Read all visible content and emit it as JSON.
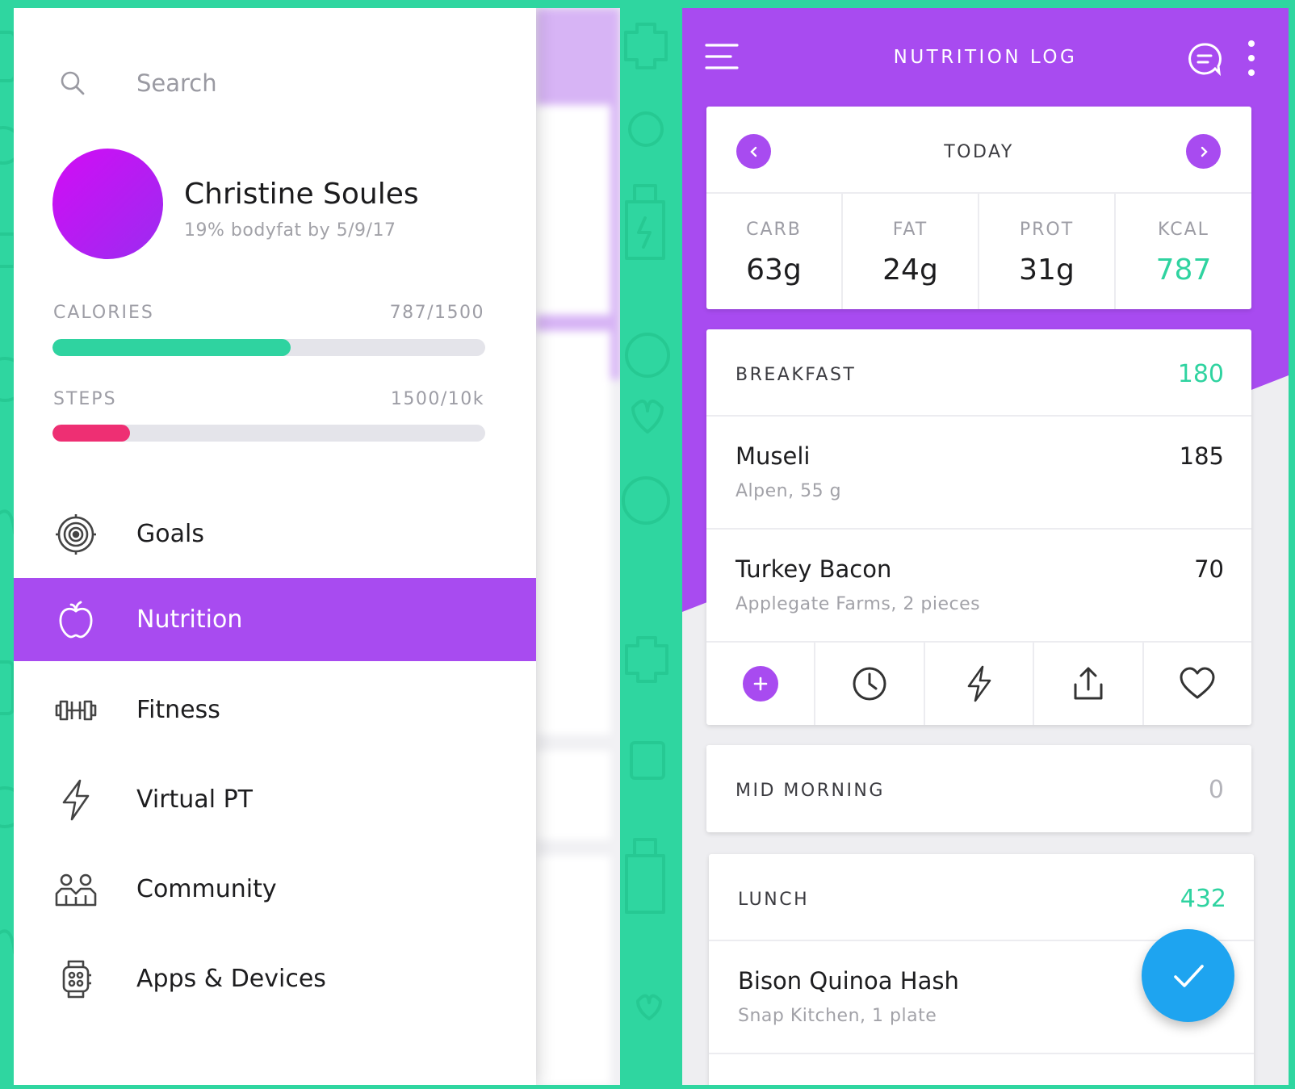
{
  "drawer": {
    "search_placeholder": "Search",
    "profile": {
      "name": "Christine Soules",
      "goal": "19% bodyfat by 5/9/17"
    },
    "stats": [
      {
        "label": "CALORIES",
        "value": "787/1500",
        "progress": 0.55,
        "color": "#2fd3a0"
      },
      {
        "label": "STEPS",
        "value": "1500/10k",
        "progress": 0.18,
        "color": "#ee2f73"
      }
    ],
    "nav": [
      {
        "label": "Goals",
        "icon": "target-icon",
        "active": false
      },
      {
        "label": "Nutrition",
        "icon": "apple-icon",
        "active": true
      },
      {
        "label": "Fitness",
        "icon": "dumbbell-icon",
        "active": false
      },
      {
        "label": "Virtual PT",
        "icon": "lightning-icon",
        "active": false
      },
      {
        "label": "Community",
        "icon": "people-icon",
        "active": false
      },
      {
        "label": "Apps & Devices",
        "icon": "smartwatch-icon",
        "active": false
      }
    ]
  },
  "log": {
    "title": "NUTRITION LOG",
    "date_label": "TODAY",
    "macros": [
      {
        "label": "CARB",
        "value": "63g"
      },
      {
        "label": "FAT",
        "value": "24g"
      },
      {
        "label": "PROT",
        "value": "31g"
      },
      {
        "label": "KCAL",
        "value": "787"
      }
    ],
    "meals": {
      "breakfast": {
        "title": "BREAKFAST",
        "total": "180",
        "items": [
          {
            "name": "Museli",
            "desc": "Alpen, 55 g",
            "cal": "185"
          },
          {
            "name": "Turkey Bacon",
            "desc": "Applegate Farms, 2 pieces",
            "cal": "70"
          }
        ]
      },
      "mid_morning": {
        "title": "MID MORNING",
        "total": "0"
      },
      "lunch": {
        "title": "LUNCH",
        "total": "432",
        "items": [
          {
            "name": "Bison Quinoa Hash",
            "desc": "Snap Kitchen, 1 plate"
          }
        ]
      }
    },
    "actions": [
      "add-icon",
      "clock-icon",
      "lightning-icon",
      "share-icon",
      "heart-icon"
    ]
  },
  "colors": {
    "purple": "#a84bf0",
    "green": "#2fd3a0",
    "pink": "#ee2f73",
    "blue": "#1ea4f0",
    "background": "#2fd6a0"
  }
}
